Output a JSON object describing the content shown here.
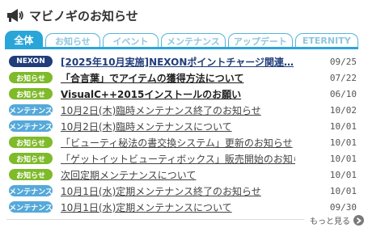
{
  "header": {
    "title": "マビノギのお知らせ",
    "icon": "megaphone-icon"
  },
  "tabs": [
    {
      "label": "全体",
      "active": true
    },
    {
      "label": "お知らせ",
      "active": false
    },
    {
      "label": "イベント",
      "active": false
    },
    {
      "label": "メンテナンス",
      "active": false
    },
    {
      "label": "アップデート",
      "active": false
    },
    {
      "label": "ETERNITY",
      "active": false
    }
  ],
  "items": [
    {
      "badge": "NEXON",
      "type": "nexon",
      "title": "[2025年10月実施]NEXONポイントチャージ関連…",
      "bold": true,
      "date": "09/25"
    },
    {
      "badge": "お知らせ",
      "type": "oshirase",
      "title": "「合言葉」でアイテムの獲得方法について",
      "bold": true,
      "date": "07/22"
    },
    {
      "badge": "お知らせ",
      "type": "oshirase",
      "title": "VisualC++2015インストールのお願い",
      "bold": true,
      "date": "06/10"
    },
    {
      "badge": "メンテナンス",
      "type": "maint",
      "title": "10月2日(木)臨時メンテナンス終了のお知らせ",
      "bold": false,
      "date": "10/02"
    },
    {
      "badge": "メンテナンス",
      "type": "maint",
      "title": "10月2日(木)臨時メンテナンスについて",
      "bold": false,
      "date": "10/01"
    },
    {
      "badge": "お知らせ",
      "type": "oshirase",
      "title": "「ビューティ秘法の書交換システム」更新のお知らせ",
      "bold": false,
      "date": "10/01"
    },
    {
      "badge": "お知らせ",
      "type": "oshirase",
      "title": "「ゲットイットビューティボックス」販売開始のお知らせ",
      "bold": false,
      "date": "10/01"
    },
    {
      "badge": "お知らせ",
      "type": "oshirase",
      "title": "次回定期メンテナンスについて",
      "bold": false,
      "date": "10/01"
    },
    {
      "badge": "メンテナンス",
      "type": "maint",
      "title": "10月1日(水)定期メンテナンス終了のお知らせ",
      "bold": false,
      "date": "10/01"
    },
    {
      "badge": "メンテナンス",
      "type": "maint",
      "title": "10月1日(水)定期メンテナンスについて",
      "bold": false,
      "date": "09/30"
    }
  ],
  "more": {
    "label": "もっと見る",
    "icon": "chevron-right-icon"
  },
  "colors": {
    "accent": "#2aa5d8",
    "nexon": "#213d7a",
    "oshirase": "#7fba2a",
    "maint": "#55a9d9"
  }
}
